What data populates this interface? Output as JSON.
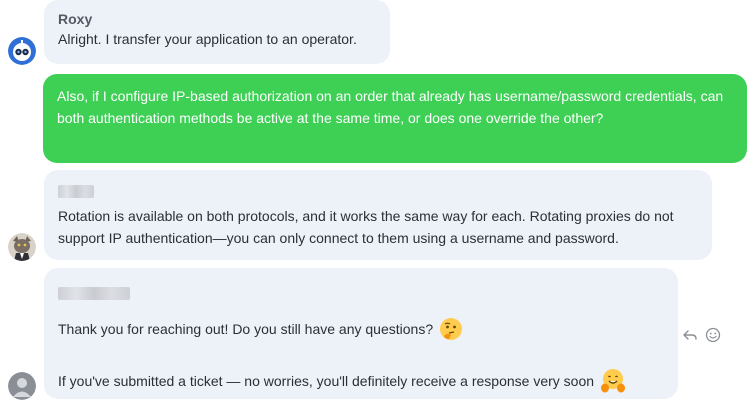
{
  "messages": [
    {
      "sender": "Roxy",
      "text": "Alright. I transfer your application to an operator."
    },
    {
      "text": "Also, if I configure IP-based authorization on an order that already has username/password credentials, can both authentication methods be active at the same time, or does one override the other?"
    },
    {
      "text": "Rotation is available on both protocols, and it works the same way for each. Rotating proxies do not support IP authentication—you can only connect to them using a username and password."
    },
    {
      "line1": "Thank you for reaching out! Do you still have any questions?",
      "line1_emoji": "thinking-face-emoji",
      "line2": "If you've submitted a ticket — no worries, you'll definitely receive a response very soon",
      "line2_emoji": "hugging-face-emoji"
    }
  ],
  "icons": {
    "bot_avatar": "robot-avatar-icon",
    "operator_avatar": "cat-avatar-icon",
    "user_avatar": "default-user-avatar-icon",
    "reply": "reply-icon",
    "react": "smiley-icon"
  },
  "colors": {
    "outgoing_bubble": "#3ecf55",
    "incoming_bubble": "#edf1f8"
  }
}
